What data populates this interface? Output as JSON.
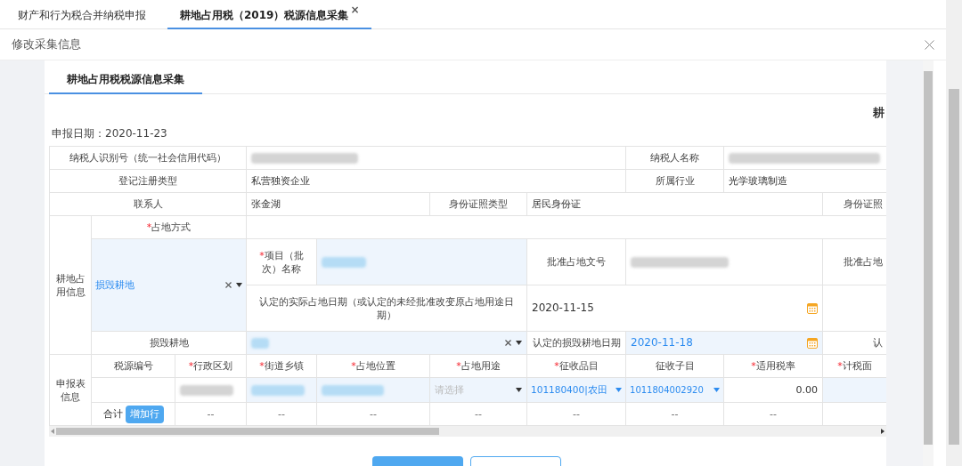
{
  "tabs": [
    {
      "label": "财产和行为税合并纳税申报",
      "selected": false,
      "closable": false
    },
    {
      "label": "耕地占用税（2019）税源信息采集",
      "selected": true,
      "closable": true
    }
  ],
  "close_glyph": "×",
  "required_mark": "*",
  "modal": {
    "title": "修改采集信息"
  },
  "inner_tabs": [
    {
      "label": "耕地占用税税源信息采集",
      "selected": true
    }
  ],
  "form_title": "耕",
  "report_date": "申报日期：2020-11-23",
  "info": {
    "taxpayer_id_label": "纳税人识别号（统一社会信用代码）",
    "taxpayer_name_label": "纳税人名称",
    "reg_type_label": "登记注册类型",
    "reg_type": "私营独资企业",
    "industry_label": "所属行业",
    "industry": "光学玻璃制造",
    "contact_label": "联系人",
    "contact": "张金湖",
    "id_type_label": "身份证照类型",
    "id_type": "居民身份证",
    "id_no_label": "身份证照"
  },
  "land": {
    "section_label": "耕地占用信息",
    "occupy_mode_label": "占地方式",
    "occupy_mode_required": true,
    "occupy_mode": "损毁耕地",
    "project_label": "项目（批次）名称",
    "project_required": true,
    "approval_no_label": "批准占地文号",
    "approval_cut_label": "批准占地",
    "actual_date_label": "认定的实际占地日期（或认定的未经批准改变原占地用途日期）",
    "actual_date": "2020-11-15",
    "damaged_label": "损毁耕地",
    "damaged_date_label": "认定的损毁耕地日期",
    "damaged_date": "2020-11-18",
    "cut_label": "认"
  },
  "report": {
    "section_label": "申报表信息",
    "columns": [
      {
        "label": "税源编号",
        "required": false
      },
      {
        "label": "行政区划",
        "required": true
      },
      {
        "label": "街道乡镇",
        "required": true
      },
      {
        "label": "占地位置",
        "required": true
      },
      {
        "label": "占地用途",
        "required": true
      },
      {
        "label": "征收品目",
        "required": true
      },
      {
        "label": "征收子目",
        "required": false
      },
      {
        "label": "适用税率",
        "required": true
      },
      {
        "label": "计税面",
        "required": true
      }
    ],
    "use_placeholder": "请选择",
    "item": "101180400|农田",
    "subitem": "1011804002920",
    "rate": "0.00",
    "total_label": "合计",
    "add_row_button": "增加行",
    "totals": [
      "--",
      "--",
      "--",
      "--",
      "--",
      "--",
      "--"
    ]
  }
}
